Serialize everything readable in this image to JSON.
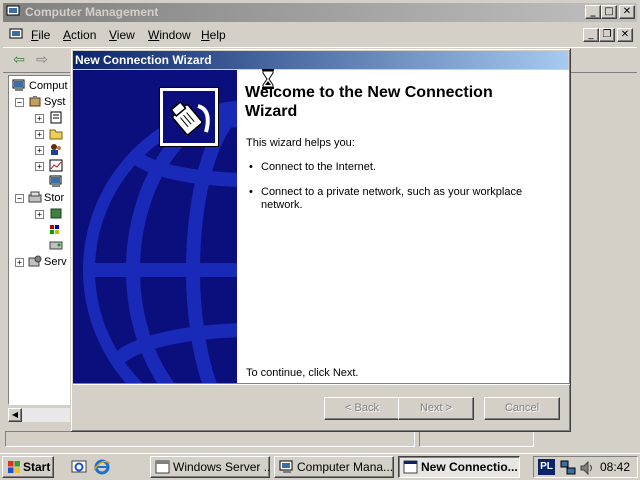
{
  "main_window": {
    "title": "Computer Management",
    "menu": [
      "File",
      "Action",
      "View",
      "Window",
      "Help"
    ],
    "tree": [
      {
        "label": "Comput",
        "expander": "none"
      },
      {
        "label": "Syst",
        "expander": "minus"
      },
      {
        "label": "Stor",
        "expander": "minus"
      },
      {
        "label": "Serv",
        "expander": "plus"
      }
    ]
  },
  "wizard": {
    "title": "New Connection Wizard",
    "heading": "Welcome to the New Connection Wizard",
    "intro": "This wizard helps you:",
    "bullets": [
      "Connect to the Internet.",
      "Connect to a private network, such as your workplace network."
    ],
    "continue_text": "To continue, click Next.",
    "buttons": {
      "back": "< Back",
      "next": "Next >",
      "cancel": "Cancel"
    }
  },
  "taskbar": {
    "start": "Start",
    "tasks": [
      {
        "label": "Windows Server ...",
        "active": false
      },
      {
        "label": "Computer Mana...",
        "active": false
      },
      {
        "label": "New Connectio...",
        "active": true
      }
    ],
    "language": "PL",
    "clock": "08:42"
  },
  "colors": {
    "wizard_title_start": "#0a246a",
    "wizard_title_end": "#a6caf0",
    "wizard_side_panel": "#0b0f7e",
    "inactive_title_start": "#808080",
    "inactive_title_end": "#c0c0c0"
  },
  "icons": [
    "computer-management-icon",
    "back-arrow-icon",
    "forward-arrow-icon",
    "network-cable-icon",
    "globe-icon",
    "hourglass-icon",
    "windows-logo-icon",
    "ie-icon",
    "desktop-icon",
    "network-tray-icon",
    "volume-icon"
  ]
}
